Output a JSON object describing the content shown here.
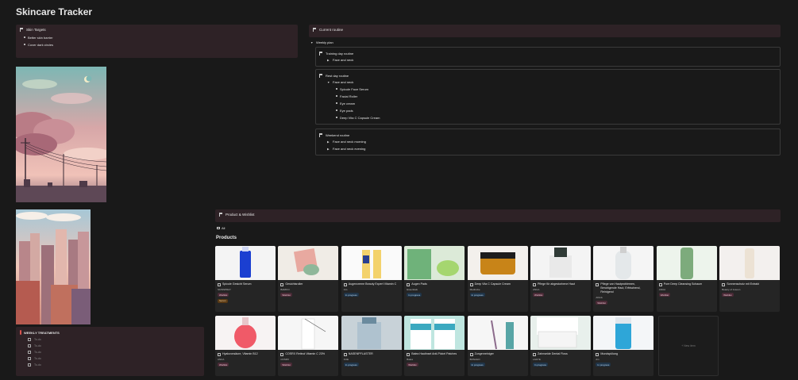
{
  "title": "Skincare Tracker",
  "skin_targets": {
    "heading": "Skin Targets",
    "items": [
      "Better skin barrier",
      "Cover dark circles"
    ]
  },
  "current_routine": {
    "heading": "Current routine",
    "weekly_plan": "Weekly plan",
    "training": {
      "title": "Training day routine",
      "items": [
        "Face and neck"
      ]
    },
    "rest": {
      "title": "Rest day routine",
      "parent": "Face and neck",
      "items": [
        "Spicule Face Serum",
        "Facial Roller",
        "Eye cream",
        "Eye pads",
        "Deep Vita C Capsule Cream"
      ]
    },
    "weekend": {
      "title": "Weekend routine",
      "items": [
        "Face and neck morning",
        "Face and neck evening"
      ]
    }
  },
  "weekly_treatments": {
    "heading": "WEEKLY TREATMENTS",
    "items": [
      "To-do",
      "To-do",
      "To-do",
      "To-do",
      "To-do"
    ]
  },
  "product_wishlist": {
    "heading": "Product & Wishlist",
    "view_tab": "All",
    "section_title": "Products",
    "new_label": "+ New item"
  },
  "products": [
    {
      "name": "Spicule Gesicht Serum",
      "brand": "SKINSPRAY",
      "status": "Wishlist",
      "status_type": "wish",
      "tag": "Serum"
    },
    {
      "name": "Gesichtsroller",
      "brand": "BARIKO",
      "status": "Wishlist",
      "status_type": "wish"
    },
    {
      "name": "Augencreme Beauty Expert Vitamin C",
      "brand": "Aro",
      "status": "In progress",
      "status_type": "prog"
    },
    {
      "name": "Augen Pads",
      "brand": "Essentials",
      "status": "In progress",
      "status_type": "prog"
    },
    {
      "name": "Deep Vita C Capsule Cream",
      "brand": "Medicube",
      "status": "In progress",
      "status_type": "prog"
    },
    {
      "name": "Pflege für abgestorbene Haut",
      "brand": "ANUA",
      "status": "Wishlist",
      "status_type": "wish"
    },
    {
      "name": "Pflege von Hautproblemen, Beruhigende Haut, Erfrischend, Reinigend",
      "brand": "ANUA",
      "status": "Wishlist",
      "status_type": "wish"
    },
    {
      "name": "Pore Deep Cleansing Schaum",
      "brand": "ANUA",
      "status": "Wishlist",
      "status_type": "wish"
    },
    {
      "name": "Sonnenschutz mit Extrakt",
      "brand": "Beauty of Joseon",
      "status": "Wishlist",
      "status_type": "wish"
    },
    {
      "name": "Hyaluronsäure, Vitamin B12",
      "brand": "ANUA",
      "status": "Wishlist",
      "status_type": "wish"
    },
    {
      "name": "COSRX Retinol Vitamin C 23%",
      "brand": "COSRX",
      "status": "Wishlist",
      "status_type": "wish"
    },
    {
      "name": "NASENPFLASTER",
      "brand": "KUE",
      "status": "In progress",
      "status_type": "prog"
    },
    {
      "name": "Balea Hautinsel Anti-Pickel Patches",
      "brand": "Balea",
      "status": "Wishlist",
      "status_type": "wish"
    },
    {
      "name": "Zungenreiniger",
      "brand": "BONAHO",
      "status": "In progress",
      "status_type": "prog"
    },
    {
      "name": "Zahnseide Dental Floss",
      "brand": "LADYE",
      "status": "In progress",
      "status_type": "prog"
    },
    {
      "name": "Mundspülung",
      "brand": "dm",
      "status": "In progress",
      "status_type": "prog"
    }
  ],
  "colors": {
    "background": "#191919",
    "callout": "#2e2226",
    "wishlist": "#4a2a36",
    "in_progress": "#1f3448"
  }
}
